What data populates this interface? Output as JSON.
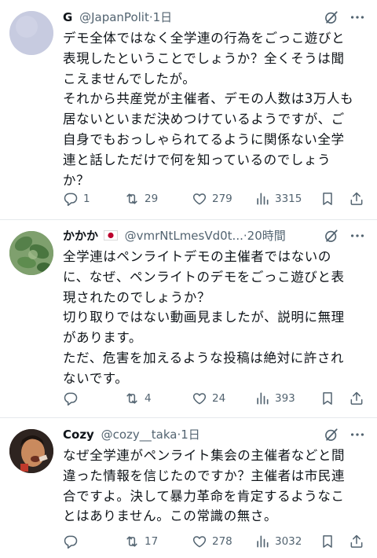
{
  "tweets": [
    {
      "name": "G",
      "handle": "@JapanPolit",
      "time": "1日",
      "lines": [
        "デモ全体ではなく全学連の行為をごっこ遊びと",
        "表現したということでしょうか？全くそうは聞",
        "こえませんでしたが。",
        "それから共産党が主催者、デモの人数は3万人も",
        "居ないといまだ決めつけているようですが、ご",
        "自身でもおっしゃられてるように関係ない全学",
        "連と話しただけで何を知っているのでしょう",
        "か？"
      ],
      "replies": "1",
      "reposts": "29",
      "likes": "279",
      "views": "3315"
    },
    {
      "name": "かかか",
      "flag": "japan-flag-emoji",
      "handle": "@vmrNtLmesVd0t...",
      "time": "20時間",
      "lines": [
        "全学連はペンライトデモの主催者ではないの",
        "に、なぜ、ペンライトのデモをごっこ遊びと表",
        "現されたのでしょうか？",
        "切り取りではない動画見ましたが、説明に無理",
        "があります。",
        "ただ、危害を加えるような投稿は絶対に許され",
        "ないです。"
      ],
      "replies": "",
      "reposts": "4",
      "likes": "24",
      "views": "393"
    },
    {
      "name": "Cozy",
      "handle": "@cozy__taka",
      "time": "1日",
      "lines": [
        "なぜ全学連がペンライト集会の主催者などと間",
        "違った情報を信じたのですか？主催者は市民連",
        "合ですよ。決して暴力革命を肯定するようなこ",
        "とはありません。この常識の無さ。"
      ],
      "replies": "",
      "reposts": "17",
      "likes": "278",
      "views": "3032"
    }
  ],
  "colors": {
    "text": "#0f1419",
    "secondary": "#536471",
    "separator": "#e6e9ec"
  }
}
